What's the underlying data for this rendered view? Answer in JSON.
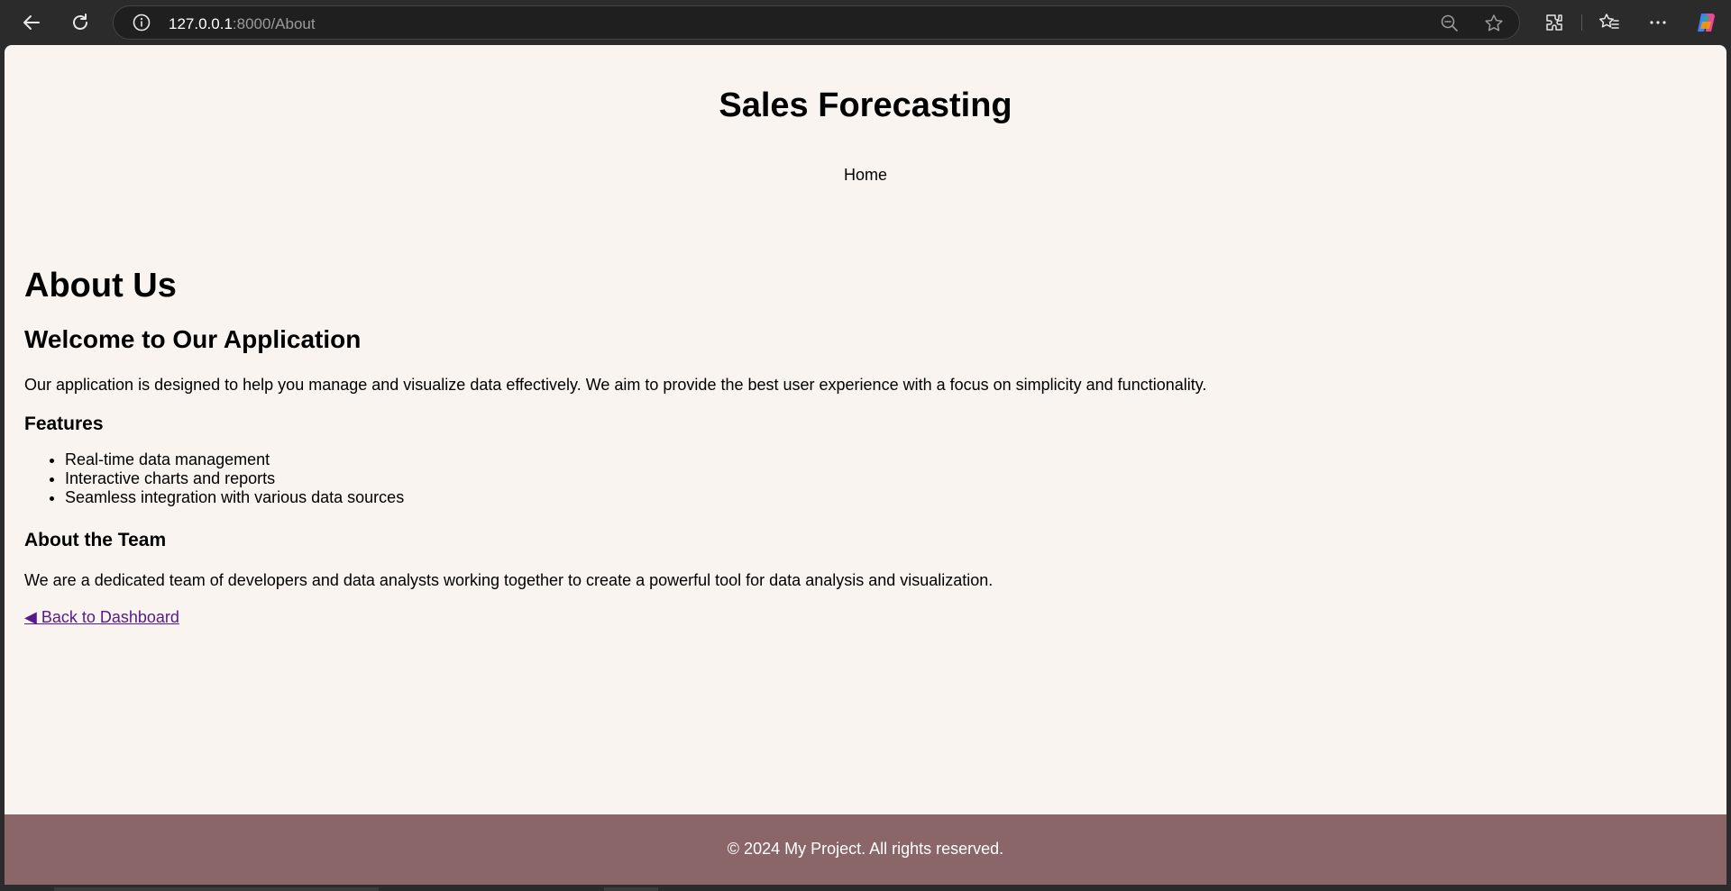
{
  "browser": {
    "url_host": "127.0.0.1",
    "url_rest": ":8000/About",
    "icons": [
      "back-arrow-icon",
      "refresh-icon",
      "info-icon",
      "zoom-out-icon",
      "star-icon",
      "extensions-icon",
      "favorites-icon",
      "more-icon",
      "copilot-icon"
    ]
  },
  "header": {
    "title": "Sales Forecasting",
    "nav": [
      {
        "label": "Home"
      }
    ]
  },
  "main": {
    "heading": "About Us",
    "welcome_heading": "Welcome to Our Application",
    "intro": "Our application is designed to help you manage and visualize data effectively. We aim to provide the best user experience with a focus on simplicity and functionality.",
    "features_heading": "Features",
    "features": [
      "Real-time data management",
      "Interactive charts and reports",
      "Seamless integration with various data sources"
    ],
    "team_heading": "About the Team",
    "team_text": "We are a dedicated team of developers and data analysts working together to create a powerful tool for data analysis and visualization.",
    "back_link": "◀ Back to Dashboard"
  },
  "footer": {
    "text": "© 2024 My Project. All rights reserved."
  },
  "colors": {
    "page_background": "#f9f4ef",
    "footer_background": "#8a6669",
    "link_visited": "#551a8b",
    "browser_chrome": "#2b2b2b"
  }
}
